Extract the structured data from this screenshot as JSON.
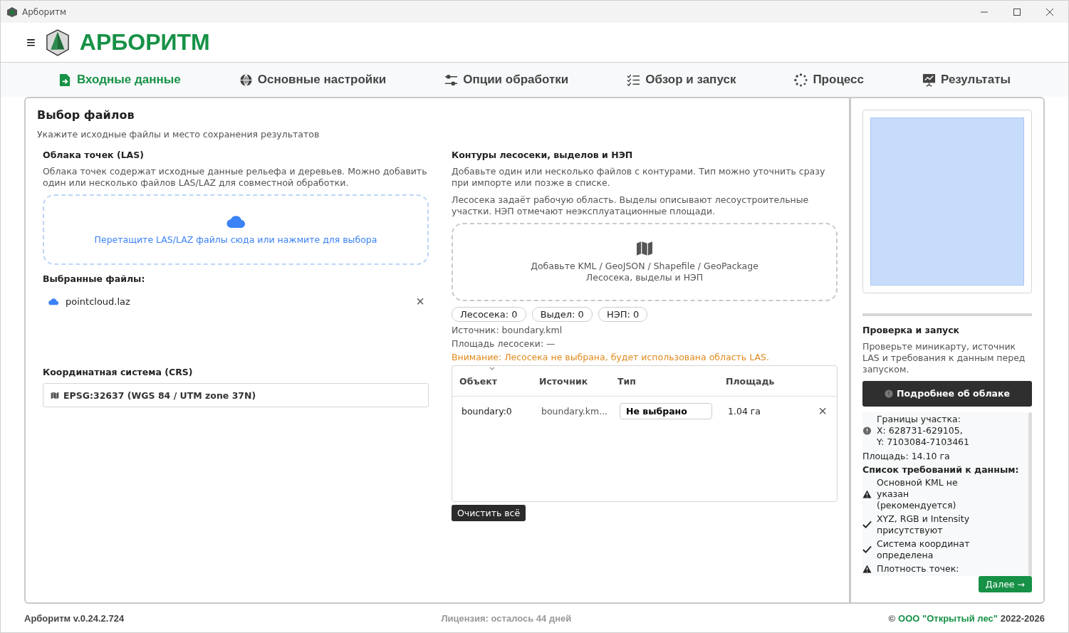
{
  "window": {
    "title": "Арборитм"
  },
  "header": {
    "menu_glyph": "≡",
    "logo_text": "АРБОРИТМ"
  },
  "tabs": [
    {
      "label": "Входные данные",
      "kind": "file",
      "selected": true
    },
    {
      "label": "Основные настройки",
      "kind": "globe",
      "selected": false
    },
    {
      "label": "Опции обработки",
      "kind": "sliders",
      "selected": false
    },
    {
      "label": "Обзор и запуск",
      "kind": "checklist",
      "selected": false
    },
    {
      "label": "Процесс",
      "kind": "spinner",
      "selected": false
    },
    {
      "label": "Результаты",
      "kind": "chart",
      "selected": false
    }
  ],
  "page": {
    "title": "Выбор файлов",
    "subtitle": "Укажите исходные файлы и место сохранения результатов"
  },
  "las": {
    "title": "Облака точек (LAS)",
    "description": "Облака точек содержат исходные данные рельефа и деревьев. Можно добавить один или несколько файлов LAS/LAZ для совместной обработки.",
    "dropzone": "Перетащите LAS/LAZ файлы сюда или нажмите для выбора",
    "selected_title": "Выбранные файлы:",
    "files": [
      {
        "name": "pointcloud.laz",
        "remove": "×"
      }
    ]
  },
  "crs": {
    "title": "Координатная система (CRS)",
    "value": "EPSG:32637 (WGS 84 / UTM zone 37N)"
  },
  "contours": {
    "title": "Контуры лесосеки, выделов и НЭП",
    "description": "Добавьте один или несколько файлов с контурами. Тип можно уточнить сразу при импорте или позже в списке.",
    "note": "Лесосека задаёт рабочую область. Выделы описывают лесоустроительные участки. НЭП отмечают неэксплуатационные площади.",
    "dropzone_line1": "Добавьте KML / GeoJSON / Shapefile / GeoPackage",
    "dropzone_line2": "Лесосека, выделы и НЭП",
    "counters": [
      "Лесосека: 0",
      "Выдел: 0",
      "НЭП: 0"
    ],
    "source": "Источник: boundary.kml",
    "area": "Площадь лесосеки: —",
    "warning": "Внимание: Лесосека не выбрана, будет использована область LAS.",
    "table": {
      "columns": [
        "Объект",
        "Источник",
        "Тип",
        "Площадь"
      ],
      "rows": [
        {
          "object": "boundary:0",
          "source": "boundary.km...",
          "type": "Не выбрано",
          "area": "1.04 га",
          "remove": "×"
        }
      ]
    },
    "clear_button": "Очистить всё"
  },
  "sidebar": {
    "title": "Проверка и запуск",
    "description": "Проверьте миникарту, источник LAS и требования к данным перед запуском.",
    "details_button": "Подробнее об облаке",
    "bounds": [
      "Границы участка:",
      "X: 628731-629105,",
      "Y: 7103084-7103461"
    ],
    "area": "Площадь: 14.10 га",
    "requirements_title": "Список требований к данным:",
    "requirements": [
      {
        "kind": "warning",
        "text": "Основной KML не указан (рекомендуется)"
      },
      {
        "kind": "ok",
        "text": "XYZ, RGB и Intensity присутствуют"
      },
      {
        "kind": "ok",
        "text": "Система координат определена"
      },
      {
        "kind": "warning",
        "text": "Плотность точек:"
      }
    ],
    "next_button": "Далее →"
  },
  "footer": {
    "version": "Арборитм v.0.24.2.724",
    "license": "Лицензия: осталось 44 дней",
    "copyright_sign": "©",
    "company": "ООО \"Открытый лес\"",
    "years": "2022-2026"
  }
}
